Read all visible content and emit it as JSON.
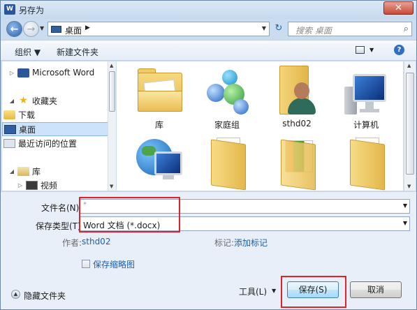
{
  "window": {
    "title": "另存为",
    "app_logo": "W",
    "close_label": "✕"
  },
  "nav": {
    "back_icon": "back-arrow-icon",
    "forward_icon": "forward-arrow-icon",
    "address": "桌面",
    "address_chevron": "▶",
    "refresh_icon": "refresh-icon",
    "search_placeholder": "搜索 桌面"
  },
  "toolbar": {
    "organize": "组织 ▼",
    "new_folder": "新建文件夹",
    "help": "?"
  },
  "sidebar": {
    "items": [
      {
        "label": "Microsoft Word",
        "icon": "word-icon"
      },
      {
        "label": "收藏夹",
        "icon": "star-icon"
      },
      {
        "label": "下载",
        "icon": "folder-icon"
      },
      {
        "label": "桌面",
        "icon": "desktop-icon",
        "selected": true
      },
      {
        "label": "最近访问的位置",
        "icon": "recent-icon"
      },
      {
        "label": "库",
        "icon": "library-icon"
      },
      {
        "label": "视频",
        "icon": "video-icon"
      }
    ]
  },
  "files": [
    {
      "label": "库",
      "icon": "library-folder-icon"
    },
    {
      "label": "家庭组",
      "icon": "homegroup-icon"
    },
    {
      "label": "sthd02",
      "icon": "user-folder-icon"
    },
    {
      "label": "计算机",
      "icon": "computer-icon"
    },
    {
      "label": "",
      "icon": "network-icon"
    },
    {
      "label": "",
      "icon": "folder-icon"
    },
    {
      "label": "",
      "icon": "folder-icon"
    },
    {
      "label": "",
      "icon": "folder-icon"
    }
  ],
  "form": {
    "filename_label": "文件名(N):",
    "filename_value": "*",
    "type_label": "保存类型(T):",
    "type_value": "Word 文档 (*.docx)",
    "author_label": "作者:",
    "author_value": "sthd02",
    "tags_label": "标记:",
    "tags_value": "添加标记",
    "thumbnail_label": "保存缩略图",
    "hide_folders": "隐藏文件夹",
    "tools": "工具(L)",
    "save": "保存(S)",
    "cancel": "取消"
  },
  "accent_colors": {
    "highlight": "#e0222a",
    "link": "#1c5fb0",
    "selected": "#cde3fb"
  }
}
